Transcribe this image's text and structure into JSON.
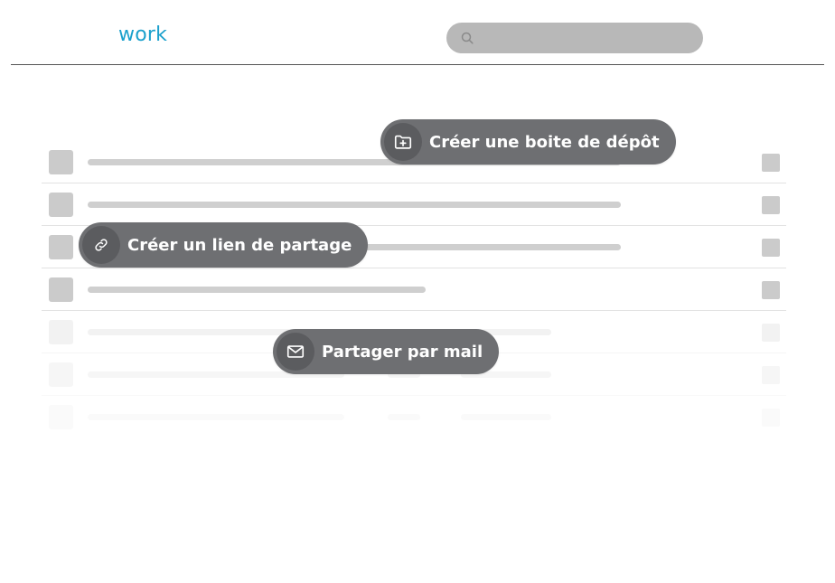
{
  "header": {
    "logo_text": "work",
    "search": {
      "placeholder": "",
      "icon": "search-icon"
    }
  },
  "colors": {
    "brand": "#1ba0cc",
    "pill_background": "#6e6f72",
    "pill_icon_background": "#5b5c5f",
    "skeleton": "#cfcfcf"
  },
  "actions": [
    {
      "label": "Créer une boite de dépôt",
      "icon": "folder-plus-icon"
    },
    {
      "label": "Créer un lien de partage",
      "icon": "link-icon"
    },
    {
      "label": "Partager par mail",
      "icon": "mail-icon"
    }
  ]
}
